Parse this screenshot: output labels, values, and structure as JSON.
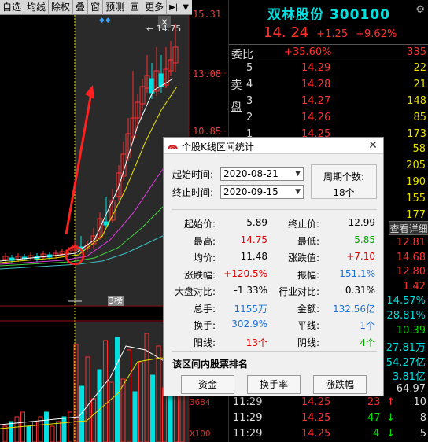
{
  "toolbar": {
    "items": [
      "自选",
      "均线",
      "除权",
      "叠",
      "窗",
      "预测",
      "画",
      "更多"
    ],
    "diamonds": "◆◆"
  },
  "chart": {
    "price_axis": [
      "15.31",
      "13.08",
      "10.85"
    ],
    "peak_label": "← 14.75",
    "bang_tag": "3榜",
    "vol_axis": [
      "3684",
      "X100"
    ],
    "colors": {
      "up": "#ff3030",
      "down": "#00e0e0",
      "ma5": "#ffffff",
      "ma10": "#e8e000",
      "ma20": "#e040e0",
      "ma30": "#40d040",
      "ma60": "#40c0c0",
      "selection": "#2a2a2a"
    }
  },
  "quote": {
    "title": "双林股份 300100",
    "price": "14. 24",
    "change": "+1.25",
    "change_pct": "+9.62%",
    "webi_label": "委比",
    "webi_value": "+35.60%",
    "webi_diff": "335",
    "ask_label": "卖盘",
    "order_book": [
      {
        "level": "5",
        "price": "14.29",
        "vol": "22"
      },
      {
        "level": "4",
        "price": "14.28",
        "vol": "21"
      },
      {
        "level": "3",
        "price": "14.27",
        "vol": "148"
      },
      {
        "level": "2",
        "price": "14.26",
        "vol": "85"
      },
      {
        "level": "1",
        "price": "14.25",
        "vol": "173"
      }
    ],
    "side_vols": [
      "58",
      "205",
      "190",
      "155",
      "177"
    ],
    "detail_tab": "查看详细",
    "side_values": [
      {
        "text": "12.81",
        "color": "#ff3030"
      },
      {
        "text": "14.68",
        "color": "#ff3030"
      },
      {
        "text": "12.80",
        "color": "#ff3030"
      },
      {
        "text": "1.42",
        "color": "#ff3030"
      },
      {
        "text": "14.57%",
        "color": "#00e0e0"
      },
      {
        "text": "28.81%",
        "color": "#00e0e0"
      },
      {
        "text": "10.39",
        "color": "#00e000"
      },
      {
        "text": "27.81万",
        "color": "#00e0e0"
      },
      {
        "text": "54.27亿",
        "color": "#00e0e0"
      },
      {
        "text": "3.81亿",
        "color": "#00e0e0"
      },
      {
        "text": "64.97",
        "color": "#dddddd"
      }
    ],
    "ticks": [
      {
        "time": "11:29",
        "price": "14.25",
        "vol": "23",
        "flag": "10"
      },
      {
        "time": "11:29",
        "price": "14.25",
        "vol": "47",
        "flag": "8"
      },
      {
        "time": "11:29",
        "price": "14.25",
        "vol": "4",
        "flag": "5"
      }
    ]
  },
  "dialog": {
    "title": "个股K线区间统计",
    "start_label": "起始时间:",
    "start_date": "2020-08-21",
    "end_label": "终止时间:",
    "end_date": "2020-09-15",
    "period_label": "周期个数:",
    "period_value": "18个",
    "stats": [
      {
        "k1": "起始价:",
        "v1": "5.89",
        "c1": "c-blk",
        "k2": "终止价:",
        "v2": "12.99",
        "c2": "c-blk"
      },
      {
        "k1": "最高:",
        "v1": "14.75",
        "c1": "c-red",
        "k2": "最低:",
        "v2": "5.85",
        "c2": "c-grn"
      },
      {
        "k1": "均价:",
        "v1": "11.48",
        "c1": "c-blk",
        "k2": "涨跌值:",
        "v2": "+7.10",
        "c2": "c-red"
      },
      {
        "k1": "涨跌幅:",
        "v1": "+120.5%",
        "c1": "c-red",
        "k2": "振幅:",
        "v2": "151.1%",
        "c2": "c-blu"
      },
      {
        "k1": "大盘对比:",
        "v1": "-1.33%",
        "c1": "c-blk",
        "k2": "行业对比:",
        "v2": "0.31%",
        "c2": "c-blk"
      },
      {
        "k1": "总手:",
        "v1": "1155万",
        "c1": "c-blu",
        "k2": "金额:",
        "v2": "132.56亿",
        "c2": "c-blu"
      },
      {
        "k1": "换手:",
        "v1": "302.9%",
        "c1": "c-blu",
        "k2": "平线:",
        "v2": "1个",
        "c2": "c-blu"
      },
      {
        "k1": "阳线:",
        "v1": "13个",
        "c1": "c-red",
        "k2": "阴线:",
        "v2": "4个",
        "c2": "c-grn"
      }
    ],
    "rank_title": "该区间内股票排名",
    "buttons": [
      "资金",
      "换手率",
      "涨跌幅"
    ]
  }
}
